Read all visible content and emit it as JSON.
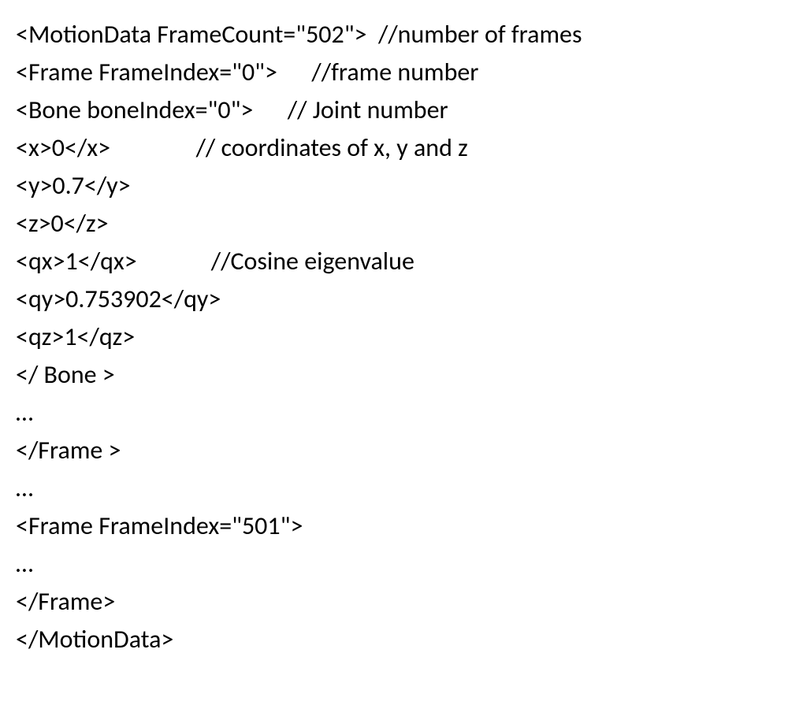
{
  "lines": [
    "<MotionData FrameCount=\"502\">  //number of frames",
    "<Frame FrameIndex=\"0\">      //frame number",
    "<Bone boneIndex=\"0\">      // Joint number",
    "<x>0</x>               // coordinates of x, y and z",
    "<y>0.7</y>",
    "<z>0</z>",
    "<qx>1</qx>             //Cosine eigenvalue",
    "<qy>0.753902</qy>",
    "<qz>1</qz>",
    "</ Bone >",
    "…",
    "</Frame >",
    "…",
    "<Frame FrameIndex=\"501\">",
    "…",
    "</Frame>",
    "</MotionData>"
  ]
}
